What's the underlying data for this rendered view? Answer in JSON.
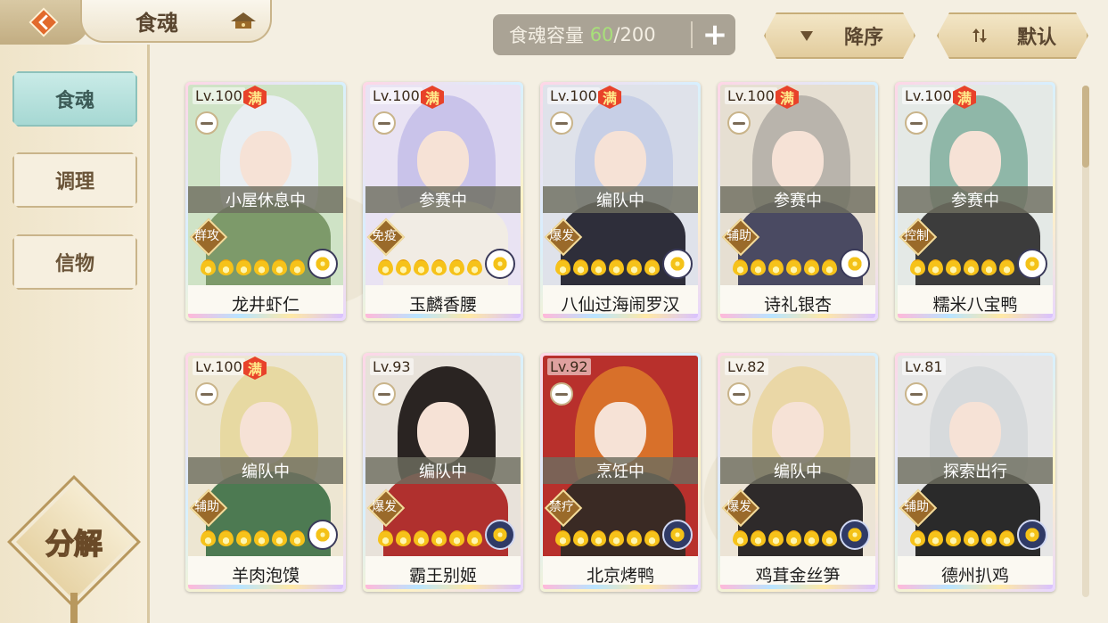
{
  "header": {
    "title": "食魂",
    "capacity_label": "食魂容量",
    "capacity_current": "60",
    "capacity_max": "/200",
    "add_label": "+",
    "sort_desc_label": "降序",
    "sort_default_label": "默认"
  },
  "sidebar": {
    "items": [
      {
        "label": "食魂",
        "active": true
      },
      {
        "label": "调理",
        "active": false
      },
      {
        "label": "信物",
        "active": false
      }
    ],
    "decompose_label": "分解"
  },
  "colors": {
    "accent_teal": "#a6d8d3",
    "full_badge": "#e8422a",
    "capacity_highlight": "#a8e07a"
  },
  "cards": [
    {
      "level": "Lv.100",
      "full": true,
      "full_label": "满",
      "status": "小屋休息中",
      "role": "群攻",
      "stars": 6,
      "name": "龙井虾仁",
      "hair": "#e9eef2",
      "robe": "#7d9a6a",
      "bg": "#cfe3c6",
      "attr": "light"
    },
    {
      "level": "Lv.100",
      "full": true,
      "full_label": "满",
      "status": "参赛中",
      "role": "免疫",
      "stars": 6,
      "name": "玉麟香腰",
      "hair": "#c9c3ea",
      "robe": "#f1ece4",
      "bg": "#e9e3f3",
      "attr": "light"
    },
    {
      "level": "Lv.100",
      "full": true,
      "full_label": "满",
      "status": "编队中",
      "role": "爆发",
      "stars": 6,
      "name": "八仙过海闹罗汉",
      "hair": "#c7cfe6",
      "robe": "#2e2e3a",
      "bg": "#dfe2ea",
      "attr": "light"
    },
    {
      "level": "Lv.100",
      "full": true,
      "full_label": "满",
      "status": "参赛中",
      "role": "辅助",
      "stars": 6,
      "name": "诗礼银杏",
      "hair": "#b9b4ac",
      "robe": "#4a4a62",
      "bg": "#e6dfd2",
      "attr": "light"
    },
    {
      "level": "Lv.100",
      "full": true,
      "full_label": "满",
      "status": "参赛中",
      "role": "控制",
      "stars": 6,
      "name": "糯米八宝鸭",
      "hair": "#8fb7a8",
      "robe": "#3c3c3c",
      "bg": "#e4e9e6",
      "attr": "light"
    },
    {
      "level": "Lv.100",
      "full": true,
      "full_label": "满",
      "status": "编队中",
      "role": "辅助",
      "stars": 6,
      "name": "羊肉泡馍",
      "hair": "#e7d9a2",
      "robe": "#4d7a52",
      "bg": "#ede6d2",
      "attr": "light"
    },
    {
      "level": "Lv.93",
      "full": false,
      "full_label": "",
      "status": "编队中",
      "role": "爆发",
      "stars": 6,
      "name": "霸王别姬",
      "hair": "#2a2422",
      "robe": "#b0302e",
      "bg": "#e8e2da",
      "attr": "dark"
    },
    {
      "level": "Lv.92",
      "full": false,
      "full_label": "",
      "status": "烹饪中",
      "role": "禁疗",
      "stars": 6,
      "name": "北京烤鸭",
      "hair": "#d8702a",
      "robe": "#3a2a24",
      "bg": "#b8302c",
      "attr": "dark"
    },
    {
      "level": "Lv.82",
      "full": false,
      "full_label": "",
      "status": "编队中",
      "role": "爆发",
      "stars": 6,
      "name": "鸡茸金丝笋",
      "hair": "#ead7a6",
      "robe": "#2e2a2a",
      "bg": "#ece4d6",
      "attr": "dark"
    },
    {
      "level": "Lv.81",
      "full": false,
      "full_label": "",
      "status": "探索出行",
      "role": "辅助",
      "stars": 6,
      "name": "德州扒鸡",
      "hair": "#d7dadc",
      "robe": "#2a2a2a",
      "bg": "#e6e6e6",
      "attr": "dark"
    }
  ]
}
